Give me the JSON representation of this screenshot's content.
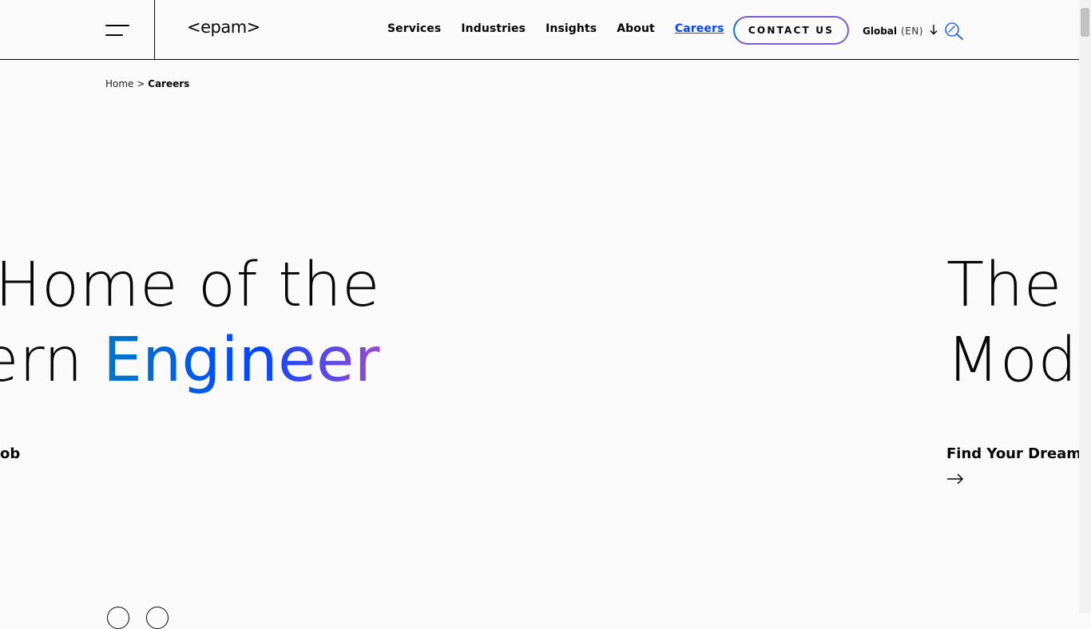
{
  "header": {
    "logo": "<epam>",
    "nav": [
      "Services",
      "Industries",
      "Insights",
      "About",
      "Careers"
    ],
    "active_nav": "Careers",
    "contact_label": "CONTACT US",
    "lang_region": "Global",
    "lang_code": "(EN)"
  },
  "breadcrumb": {
    "home": "Home",
    "sep": ">",
    "current": "Careers"
  },
  "carousel": {
    "slide_prev": {
      "line1": "Home of the",
      "line2_plain": "ern ",
      "line2_accent": "Engineer",
      "cta": "ob"
    },
    "slide_next": {
      "line1": "The",
      "line2": "Mod",
      "cta": "Find Your Dream J"
    }
  },
  "colors": {
    "accent_blue": "#0047ff",
    "gradient_purple": "#9a4ad0",
    "text": "#060606",
    "background": "#fafafa"
  },
  "icons": [
    "menu-icon",
    "chevron-down-icon",
    "search-icon",
    "arrow-right-icon"
  ]
}
